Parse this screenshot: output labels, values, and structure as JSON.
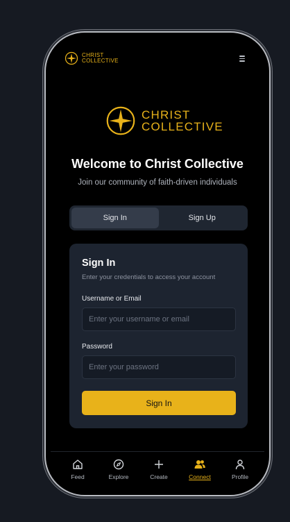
{
  "header": {
    "logo_line1": "CHRIST",
    "logo_line2": "COLLECTIVE",
    "menu_icon": "menu-icon"
  },
  "brand": {
    "line1": "CHRIST",
    "line2": "COLLECTIVE",
    "accent": "#e8b21a"
  },
  "welcome": {
    "title": "Welcome to Christ Collective",
    "subtitle": "Join our community of faith-driven individuals"
  },
  "tabs": [
    {
      "label": "Sign In",
      "active": true
    },
    {
      "label": "Sign Up",
      "active": false
    }
  ],
  "form": {
    "title": "Sign In",
    "description": "Enter your credentials to access your account",
    "username_label": "Username or Email",
    "username_placeholder": "Enter your username or email",
    "password_label": "Password",
    "password_placeholder": "Enter your password",
    "submit_label": "Sign In"
  },
  "nav": [
    {
      "label": "Feed",
      "icon": "home-icon"
    },
    {
      "label": "Explore",
      "icon": "compass-icon"
    },
    {
      "label": "Create",
      "icon": "plus-icon"
    },
    {
      "label": "Connect",
      "icon": "users-icon",
      "active": true
    },
    {
      "label": "Profile",
      "icon": "user-icon"
    }
  ]
}
